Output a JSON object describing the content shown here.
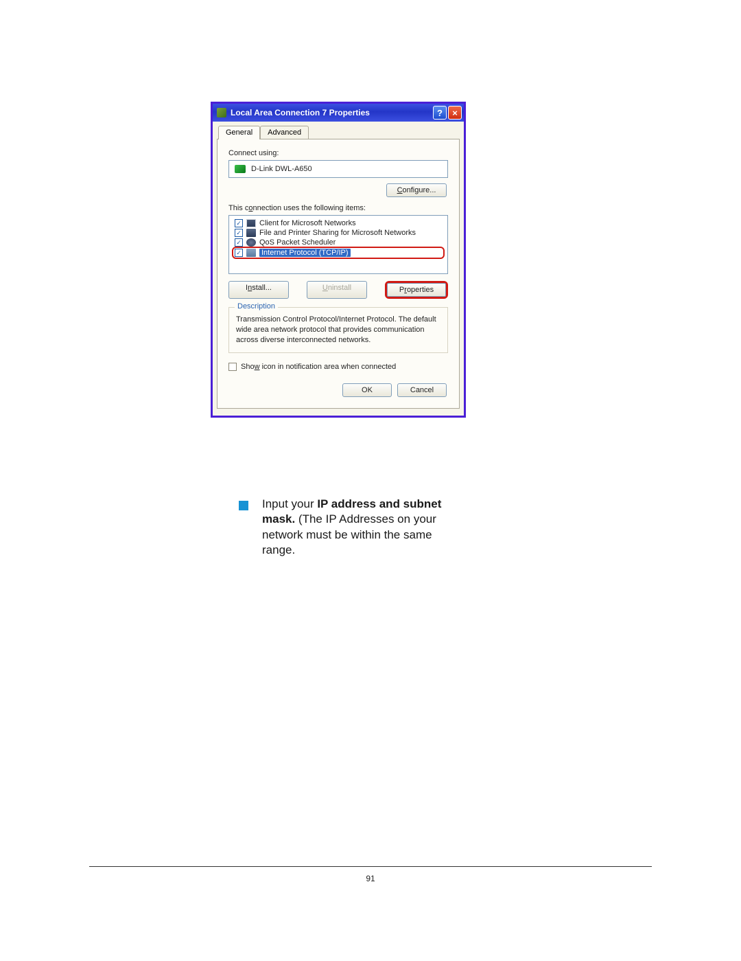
{
  "dialog": {
    "title": "Local Area Connection 7 Properties",
    "tabs": {
      "general": "General",
      "advanced": "Advanced"
    },
    "connect_using_label": "Connect using:",
    "adapter": "D-Link DWL-A650",
    "configure_btn": "Configure...",
    "items_label": "This connection uses the following items:",
    "items": [
      {
        "label": "Client for Microsoft Networks",
        "checked": true,
        "icon": "monitor"
      },
      {
        "label": "File and Printer Sharing for Microsoft Networks",
        "checked": true,
        "icon": "printer"
      },
      {
        "label": "QoS Packet Scheduler",
        "checked": true,
        "icon": "gear"
      },
      {
        "label": "Internet Protocol (TCP/IP)",
        "checked": true,
        "icon": "net",
        "selected": true,
        "highlighted": true
      }
    ],
    "install_btn": "Install...",
    "uninstall_btn": "Uninstall",
    "properties_btn": "Properties",
    "description_legend": "Description",
    "description_text": "Transmission Control Protocol/Internet Protocol. The default wide area network protocol that provides communication across diverse interconnected networks.",
    "show_icon_label": "Show icon in notification area when connected",
    "ok_btn": "OK",
    "cancel_btn": "Cancel"
  },
  "instruction": {
    "prefix": "Input your ",
    "bold": "IP address and subnet mask.",
    "suffix": " (The IP Addresses on your network must be within the same range."
  },
  "page_number": "91"
}
